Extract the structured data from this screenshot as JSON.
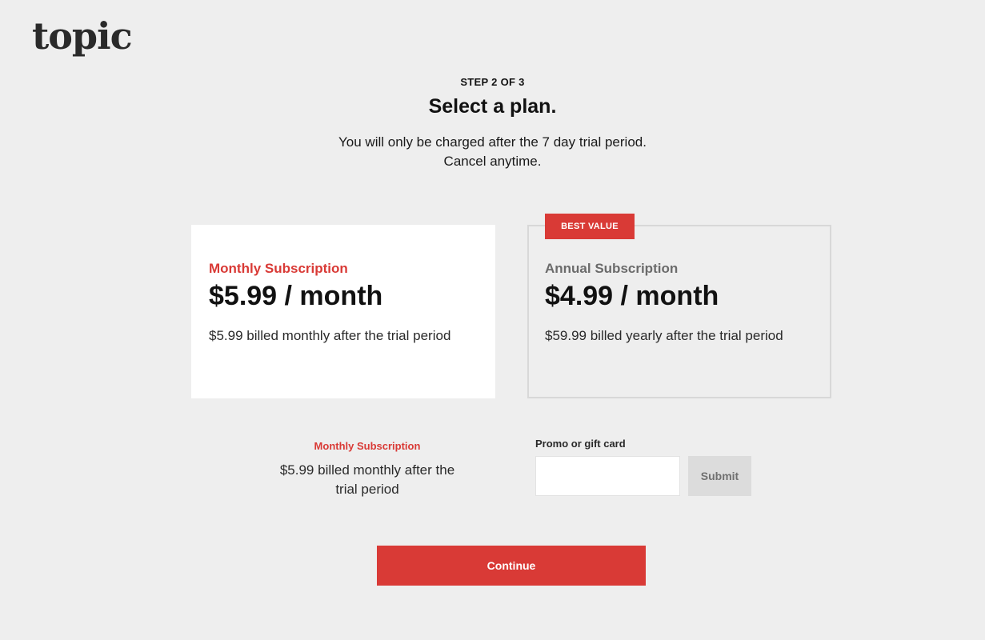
{
  "brand": {
    "logo_text": "topic",
    "accent_color": "#d93a36"
  },
  "header": {
    "step": "STEP 2 OF 3",
    "title": "Select a plan.",
    "subtitle": "You will only be charged after the 7 day trial period. Cancel anytime."
  },
  "plans": [
    {
      "name": "Monthly Subscription",
      "price": "$5.99 / month",
      "description": "$5.99 billed monthly after the trial period",
      "selected": true
    },
    {
      "name": "Annual Subscription",
      "price": "$4.99 / month",
      "description": "$59.99 billed yearly after the trial period",
      "badge": "BEST VALUE",
      "selected": false
    }
  ],
  "summary": {
    "plan_name": "Monthly Subscription",
    "description": "$5.99 billed monthly after the trial period"
  },
  "promo": {
    "label": "Promo or gift card",
    "value": "",
    "submit_label": "Submit"
  },
  "continue_label": "Continue"
}
